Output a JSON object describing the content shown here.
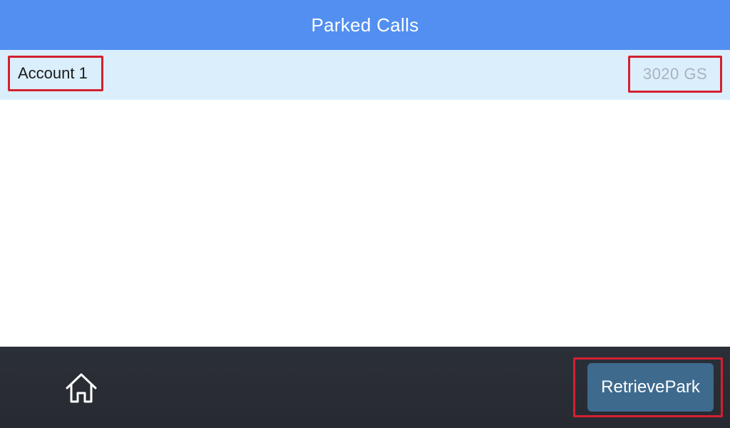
{
  "header": {
    "title": "Parked Calls"
  },
  "account": {
    "name": "Account 1",
    "model": "3020 GS"
  },
  "footer": {
    "home_icon": "home-icon",
    "retrieve_label": "RetrievePark"
  },
  "colors": {
    "title_bar": "#528ff0",
    "account_row": "#dbeefc",
    "bottom_bar": "#2b2f37",
    "retrieve_button": "#3e6a8e",
    "highlight_border": "#d42030"
  }
}
